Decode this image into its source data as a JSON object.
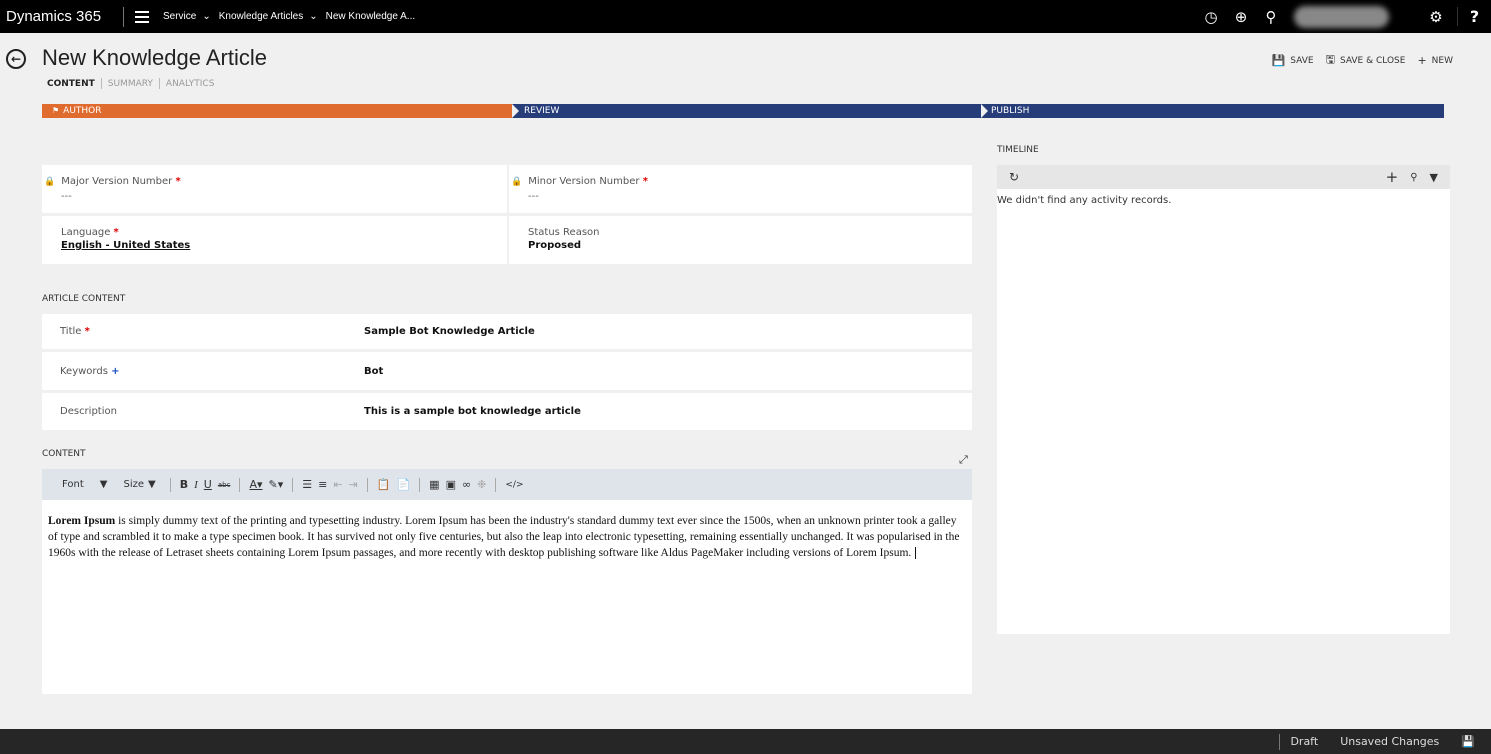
{
  "topbar": {
    "brand": "Dynamics 365",
    "module": "Service",
    "entity": "Knowledge Articles",
    "record": "New Knowledge A...",
    "icons": [
      "history-icon",
      "add-icon",
      "search-icon",
      "user-avatar",
      "gear-icon",
      "help-icon"
    ]
  },
  "header": {
    "title": "New Knowledge Article",
    "tabs": [
      {
        "label": "CONTENT",
        "active": true
      },
      {
        "label": "SUMMARY",
        "active": false
      },
      {
        "label": "ANALYTICS",
        "active": false
      }
    ],
    "commands": {
      "save": "SAVE",
      "save_close": "SAVE & CLOSE",
      "new": "NEW"
    }
  },
  "process": {
    "stages": [
      "AUTHOR",
      "REVIEW",
      "PUBLISH"
    ],
    "active": "AUTHOR",
    "colors": {
      "active": "#e06b2e",
      "inactive": "#263d7a"
    }
  },
  "fields": {
    "major_version": {
      "label": "Major Version Number",
      "required": "*",
      "value": "---"
    },
    "minor_version": {
      "label": "Minor Version Number",
      "required": "*",
      "value": "---"
    },
    "language": {
      "label": "Language",
      "required": "*",
      "value": "English - United States"
    },
    "status_reason": {
      "label": "Status Reason",
      "value": "Proposed"
    }
  },
  "article_content": {
    "heading": "ARTICLE CONTENT",
    "title": {
      "label": "Title",
      "required": "*",
      "value": "Sample Bot Knowledge Article"
    },
    "keywords": {
      "label": "Keywords",
      "recommended": "+",
      "value": "Bot"
    },
    "description": {
      "label": "Description",
      "value": "This is a sample bot knowledge article"
    }
  },
  "content": {
    "heading": "CONTENT",
    "toolbar": {
      "font": "Font",
      "size": "Size"
    },
    "body_bold": "Lorem Ipsum",
    "body_text": " is simply dummy text of the printing and typesetting industry. Lorem Ipsum has been the industry's standard dummy text ever since the 1500s, when an unknown printer took a galley of type and scrambled it to make a type specimen book. It has survived not only five centuries, but also the leap into electronic typesetting, remaining essentially unchanged. It was popularised in the 1960s with the release of Letraset sheets containing Lorem Ipsum passages, and more recently with desktop publishing software like Aldus PageMaker including versions of Lorem Ipsum."
  },
  "timeline": {
    "heading": "TIMELINE",
    "empty": "We didn't find any activity records."
  },
  "statusbar": {
    "state": "Draft",
    "changes": "Unsaved Changes"
  }
}
